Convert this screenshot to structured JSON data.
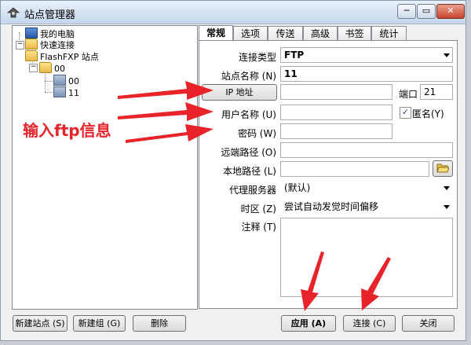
{
  "window": {
    "title": "站点管理器"
  },
  "caption_buttons": {
    "minimize": "─",
    "restore": "▭",
    "close": "✕"
  },
  "tree": {
    "items": [
      {
        "label": "我的电脑",
        "icon": "computer-icon"
      },
      {
        "label": "快速连接",
        "icon": "folder-icon"
      },
      {
        "label": "FlashFXP 站点",
        "icon": "folder-icon"
      },
      {
        "label": "00",
        "icon": "folder-icon"
      },
      {
        "label": "00",
        "icon": "server-icon"
      },
      {
        "label": "11",
        "icon": "server-icon"
      }
    ],
    "expander_minus": "−"
  },
  "tabs": [
    "常规",
    "选项",
    "传送",
    "高级",
    "书签",
    "统计"
  ],
  "form": {
    "connection_type_label": "连接类型",
    "connection_type_value": "FTP",
    "site_name_label": "站点名称 (N)",
    "site_name_value": "11",
    "ip_button": "IP 地址",
    "ip_value": "",
    "port_label": "端口",
    "port_value": "21",
    "username_label": "用户名称 (U)",
    "username_value": "",
    "anonymous_label": "匿名(Y)",
    "anonymous_checked": "✓",
    "password_label": "密码 (W)",
    "password_value": "",
    "remote_path_label": "远端路径 (O)",
    "remote_path_value": "",
    "local_path_label": "本地路径 (L)",
    "local_path_value": "",
    "proxy_label": "代理服务器",
    "proxy_value": "(默认)",
    "timezone_label": "时区 (Z)",
    "timezone_value": "尝试自动发觉时间偏移",
    "notes_label": "注释 (T)"
  },
  "annotation": {
    "text": "输入ftp信息",
    "color": "#e8232a"
  },
  "buttons": {
    "new_site": "新建站点 (S)",
    "new_group": "新建组 (G)",
    "delete": "删除",
    "apply": "应用 (A)",
    "connect": "连接 (C)",
    "close": "关闭"
  }
}
